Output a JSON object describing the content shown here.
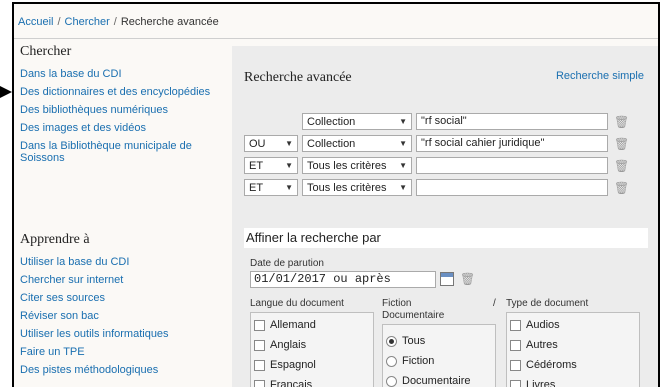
{
  "breadcrumb": {
    "home": "Accueil",
    "sep": "/",
    "search": "Chercher",
    "current": "Recherche avancée"
  },
  "sidebar": {
    "section1_title": "Chercher",
    "section1_items": [
      "Dans la base du CDI",
      "Des dictionnaires et des encyclopédies",
      "Des bibliothèques numériques",
      "Des images et des vidéos",
      "Dans la Bibliothèque municipale de Soissons"
    ],
    "section2_title": "Apprendre à",
    "section2_items": [
      "Utiliser la base du CDI",
      "Chercher sur internet",
      "Citer ses sources",
      "Réviser son bac",
      "Utiliser les outils informatiques",
      "Faire un TPE",
      "Des pistes méthodologiques"
    ]
  },
  "panel": {
    "title": "Recherche avancée",
    "simple_link": "Recherche simple",
    "criteria": [
      {
        "op": "",
        "field": "Collection",
        "value": "\"rf social\""
      },
      {
        "op": "OU",
        "field": "Collection",
        "value": "\"rf social cahier juridique\""
      },
      {
        "op": "ET",
        "field": "Tous les critères",
        "value": ""
      },
      {
        "op": "ET",
        "field": "Tous les critères",
        "value": ""
      }
    ],
    "refine_title": "Affiner la recherche par",
    "date_label": "Date de parution",
    "date_value": "01/01/2017 ou après",
    "lang_label": "Langue du document",
    "languages": [
      "Allemand",
      "Anglais",
      "Espagnol",
      "Français"
    ],
    "fiction_label": "Fiction",
    "fiction_sep": "/",
    "fiction_label2": "Documentaire",
    "fiction_options": [
      "Tous",
      "Fiction",
      "Documentaire"
    ],
    "fiction_selected": "Tous",
    "type_label": "Type de document",
    "types": [
      "Audios",
      "Autres",
      "Cédéroms",
      "Livres"
    ]
  }
}
